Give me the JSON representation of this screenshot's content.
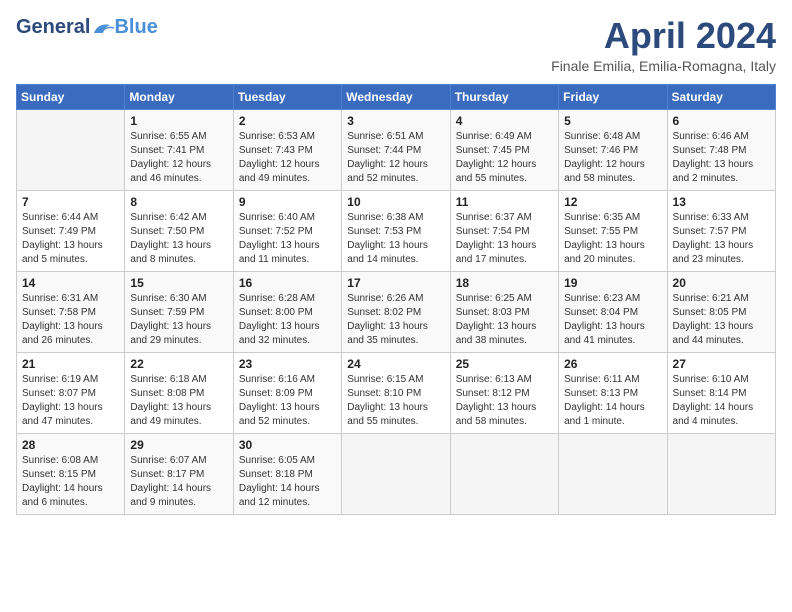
{
  "header": {
    "logo_general": "General",
    "logo_blue": "Blue",
    "title": "April 2024",
    "subtitle": "Finale Emilia, Emilia-Romagna, Italy"
  },
  "weekdays": [
    "Sunday",
    "Monday",
    "Tuesday",
    "Wednesday",
    "Thursday",
    "Friday",
    "Saturday"
  ],
  "weeks": [
    [
      {
        "day": "",
        "info": ""
      },
      {
        "day": "1",
        "info": "Sunrise: 6:55 AM\nSunset: 7:41 PM\nDaylight: 12 hours\nand 46 minutes."
      },
      {
        "day": "2",
        "info": "Sunrise: 6:53 AM\nSunset: 7:43 PM\nDaylight: 12 hours\nand 49 minutes."
      },
      {
        "day": "3",
        "info": "Sunrise: 6:51 AM\nSunset: 7:44 PM\nDaylight: 12 hours\nand 52 minutes."
      },
      {
        "day": "4",
        "info": "Sunrise: 6:49 AM\nSunset: 7:45 PM\nDaylight: 12 hours\nand 55 minutes."
      },
      {
        "day": "5",
        "info": "Sunrise: 6:48 AM\nSunset: 7:46 PM\nDaylight: 12 hours\nand 58 minutes."
      },
      {
        "day": "6",
        "info": "Sunrise: 6:46 AM\nSunset: 7:48 PM\nDaylight: 13 hours\nand 2 minutes."
      }
    ],
    [
      {
        "day": "7",
        "info": "Sunrise: 6:44 AM\nSunset: 7:49 PM\nDaylight: 13 hours\nand 5 minutes."
      },
      {
        "day": "8",
        "info": "Sunrise: 6:42 AM\nSunset: 7:50 PM\nDaylight: 13 hours\nand 8 minutes."
      },
      {
        "day": "9",
        "info": "Sunrise: 6:40 AM\nSunset: 7:52 PM\nDaylight: 13 hours\nand 11 minutes."
      },
      {
        "day": "10",
        "info": "Sunrise: 6:38 AM\nSunset: 7:53 PM\nDaylight: 13 hours\nand 14 minutes."
      },
      {
        "day": "11",
        "info": "Sunrise: 6:37 AM\nSunset: 7:54 PM\nDaylight: 13 hours\nand 17 minutes."
      },
      {
        "day": "12",
        "info": "Sunrise: 6:35 AM\nSunset: 7:55 PM\nDaylight: 13 hours\nand 20 minutes."
      },
      {
        "day": "13",
        "info": "Sunrise: 6:33 AM\nSunset: 7:57 PM\nDaylight: 13 hours\nand 23 minutes."
      }
    ],
    [
      {
        "day": "14",
        "info": "Sunrise: 6:31 AM\nSunset: 7:58 PM\nDaylight: 13 hours\nand 26 minutes."
      },
      {
        "day": "15",
        "info": "Sunrise: 6:30 AM\nSunset: 7:59 PM\nDaylight: 13 hours\nand 29 minutes."
      },
      {
        "day": "16",
        "info": "Sunrise: 6:28 AM\nSunset: 8:00 PM\nDaylight: 13 hours\nand 32 minutes."
      },
      {
        "day": "17",
        "info": "Sunrise: 6:26 AM\nSunset: 8:02 PM\nDaylight: 13 hours\nand 35 minutes."
      },
      {
        "day": "18",
        "info": "Sunrise: 6:25 AM\nSunset: 8:03 PM\nDaylight: 13 hours\nand 38 minutes."
      },
      {
        "day": "19",
        "info": "Sunrise: 6:23 AM\nSunset: 8:04 PM\nDaylight: 13 hours\nand 41 minutes."
      },
      {
        "day": "20",
        "info": "Sunrise: 6:21 AM\nSunset: 8:05 PM\nDaylight: 13 hours\nand 44 minutes."
      }
    ],
    [
      {
        "day": "21",
        "info": "Sunrise: 6:19 AM\nSunset: 8:07 PM\nDaylight: 13 hours\nand 47 minutes."
      },
      {
        "day": "22",
        "info": "Sunrise: 6:18 AM\nSunset: 8:08 PM\nDaylight: 13 hours\nand 49 minutes."
      },
      {
        "day": "23",
        "info": "Sunrise: 6:16 AM\nSunset: 8:09 PM\nDaylight: 13 hours\nand 52 minutes."
      },
      {
        "day": "24",
        "info": "Sunrise: 6:15 AM\nSunset: 8:10 PM\nDaylight: 13 hours\nand 55 minutes."
      },
      {
        "day": "25",
        "info": "Sunrise: 6:13 AM\nSunset: 8:12 PM\nDaylight: 13 hours\nand 58 minutes."
      },
      {
        "day": "26",
        "info": "Sunrise: 6:11 AM\nSunset: 8:13 PM\nDaylight: 14 hours\nand 1 minute."
      },
      {
        "day": "27",
        "info": "Sunrise: 6:10 AM\nSunset: 8:14 PM\nDaylight: 14 hours\nand 4 minutes."
      }
    ],
    [
      {
        "day": "28",
        "info": "Sunrise: 6:08 AM\nSunset: 8:15 PM\nDaylight: 14 hours\nand 6 minutes."
      },
      {
        "day": "29",
        "info": "Sunrise: 6:07 AM\nSunset: 8:17 PM\nDaylight: 14 hours\nand 9 minutes."
      },
      {
        "day": "30",
        "info": "Sunrise: 6:05 AM\nSunset: 8:18 PM\nDaylight: 14 hours\nand 12 minutes."
      },
      {
        "day": "",
        "info": ""
      },
      {
        "day": "",
        "info": ""
      },
      {
        "day": "",
        "info": ""
      },
      {
        "day": "",
        "info": ""
      }
    ]
  ]
}
